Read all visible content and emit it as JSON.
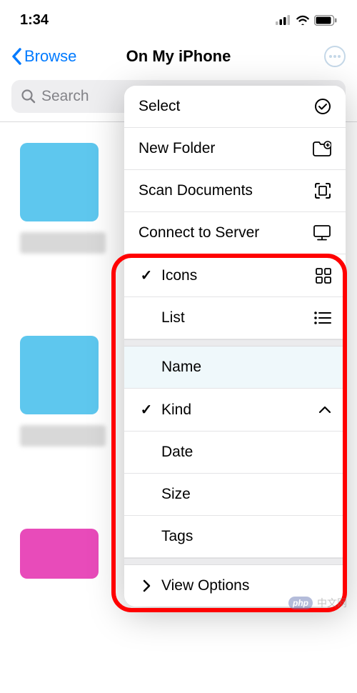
{
  "status": {
    "time": "1:34"
  },
  "nav": {
    "back_label": "Browse",
    "title": "On My iPhone"
  },
  "search": {
    "placeholder": "Search"
  },
  "menu": {
    "select": "Select",
    "new_folder": "New Folder",
    "scan_documents": "Scan Documents",
    "connect_server": "Connect to Server",
    "view": {
      "icons": "Icons",
      "list": "List"
    },
    "sort": {
      "name": "Name",
      "kind": "Kind",
      "date": "Date",
      "size": "Size",
      "tags": "Tags"
    },
    "view_options": "View Options"
  },
  "watermark": {
    "text": "中文网"
  }
}
